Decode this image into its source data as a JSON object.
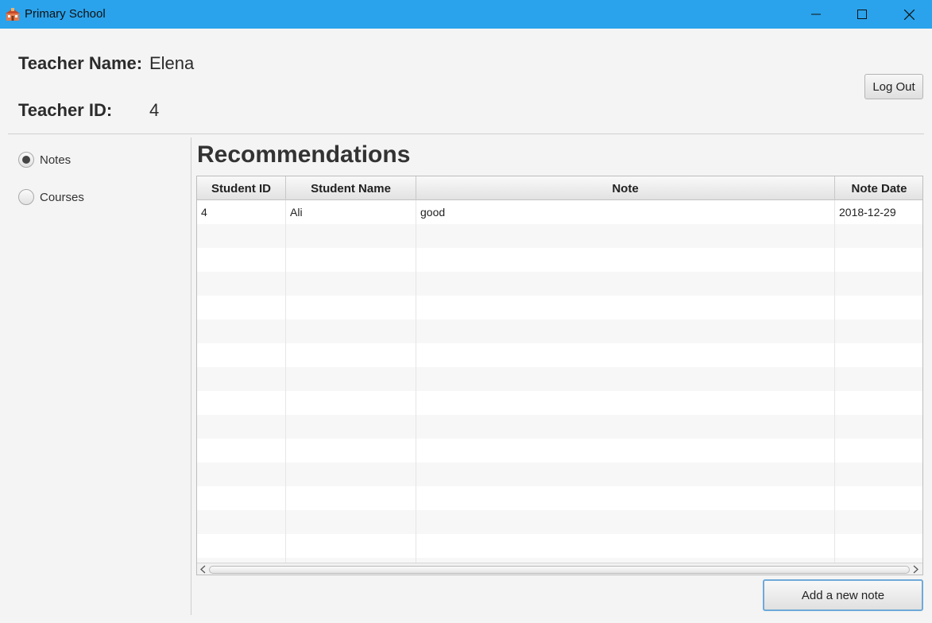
{
  "window": {
    "title": "Primary School",
    "accent_color": "#2aa3ec"
  },
  "header": {
    "teacher_name_label": "Teacher Name:",
    "teacher_name_value": "Elena",
    "teacher_id_label": "Teacher ID:",
    "teacher_id_value": "4",
    "logout_label": "Log Out"
  },
  "sidebar": {
    "options": [
      {
        "label": "Notes",
        "selected": true
      },
      {
        "label": "Courses",
        "selected": false
      }
    ]
  },
  "main": {
    "title": "Recommendations",
    "table": {
      "columns": [
        "Student ID",
        "Student Name",
        "Note",
        "Note Date"
      ],
      "rows": [
        [
          "4",
          "Ali",
          "good",
          "2018-12-29"
        ]
      ]
    },
    "add_button_label": "Add a new note"
  }
}
